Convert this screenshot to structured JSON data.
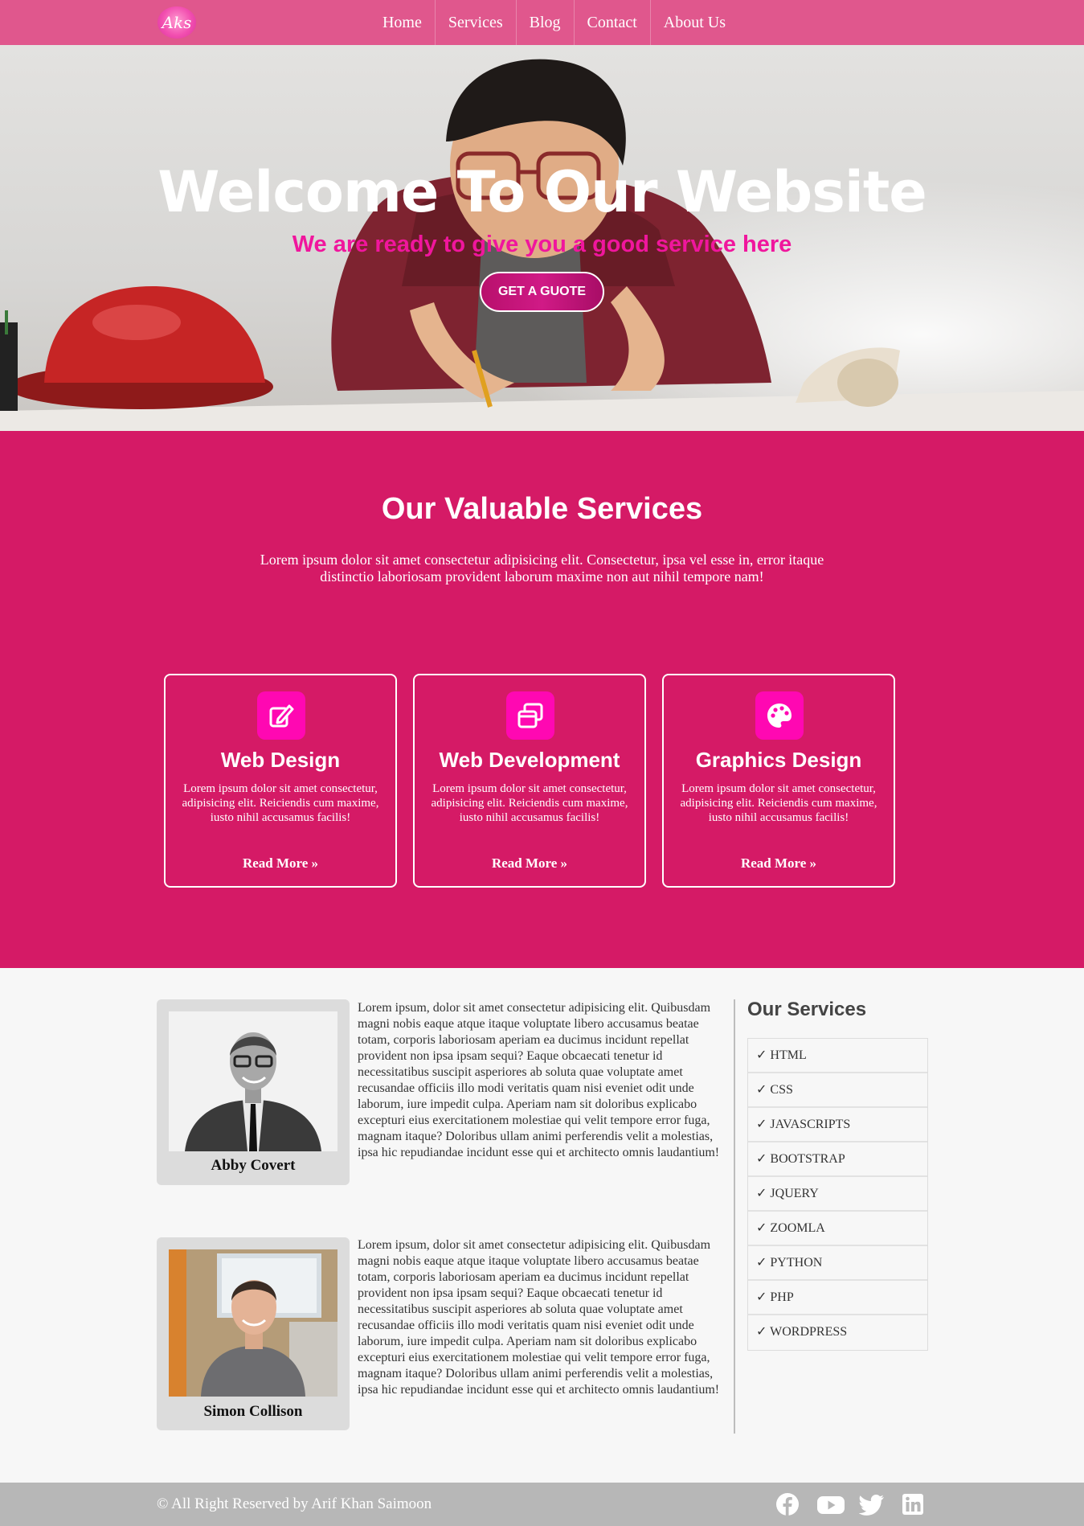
{
  "nav": {
    "logo": "Aks",
    "items": [
      "Home",
      "Services",
      "Blog",
      "Contact",
      "About Us"
    ]
  },
  "hero": {
    "title": "Welcome To Our Website",
    "subtitle": "We are ready to give you a good service here",
    "button": "GET A GUOTE"
  },
  "services_band": {
    "title": "Our Valuable Services",
    "text": "Lorem ipsum dolor sit amet consectetur adipisicing elit. Consectetur, ipsa vel esse in, error itaque distinctio laboriosam provident laborum maxime non aut nihil tempore nam!",
    "cards": [
      {
        "icon": "edit-icon",
        "title": "Web Design",
        "text": "Lorem ipsum dolor sit amet consectetur, adipisicing elit. Reiciendis cum maxime, iusto nihil accusamus facilis!",
        "link": "Read More »"
      },
      {
        "icon": "windows-icon",
        "title": "Web Development",
        "text": "Lorem ipsum dolor sit amet consectetur, adipisicing elit. Reiciendis cum maxime, iusto nihil accusamus facilis!",
        "link": "Read More »"
      },
      {
        "icon": "palette-icon",
        "title": "Graphics Design",
        "text": "Lorem ipsum dolor sit amet consectetur, adipisicing elit. Reiciendis cum maxime, iusto nihil accusamus facilis!",
        "link": "Read More »"
      }
    ]
  },
  "team": [
    {
      "name": "Abby Covert",
      "text": "Lorem ipsum, dolor sit amet consectetur adipisicing elit. Quibusdam magni nobis eaque atque itaque voluptate libero accusamus beatae totam, corporis laboriosam aperiam ea ducimus incidunt repellat provident non ipsa ipsam sequi? Eaque obcaecati tenetur id necessitatibus suscipit asperiores ab soluta quae voluptate amet recusandae officiis illo modi veritatis quam nisi eveniet odit unde laborum, iure impedit culpa. Aperiam nam sit doloribus explicabo excepturi eius exercitationem molestiae qui velit tempore error fuga, magnam itaque? Doloribus ullam animi perferendis velit a molestias, ipsa hic repudiandae incidunt esse qui et architecto omnis laudantium!"
    },
    {
      "name": "Simon Collison",
      "text": "Lorem ipsum, dolor sit amet consectetur adipisicing elit. Quibusdam magni nobis eaque atque itaque voluptate libero accusamus beatae totam, corporis laboriosam aperiam ea ducimus incidunt repellat provident non ipsa ipsam sequi? Eaque obcaecati tenetur id necessitatibus suscipit asperiores ab soluta quae voluptate amet recusandae officiis illo modi veritatis quam nisi eveniet odit unde laborum, iure impedit culpa. Aperiam nam sit doloribus explicabo excepturi eius exercitationem molestiae qui velit tempore error fuga, magnam itaque? Doloribus ullam animi perferendis velit a molestias, ipsa hic repudiandae incidunt esse qui et architecto omnis laudantium!"
    }
  ],
  "sidebar": {
    "title": "Our Services",
    "items": [
      "✓ HTML",
      "✓ CSS",
      "✓ JAVASCRIPTS",
      "✓ BOOTSTRAP",
      "✓ JQUERY",
      "✓ ZOOMLA",
      "✓ PYTHON",
      "✓ PHP",
      "✓ WORDPRESS"
    ]
  },
  "footer": {
    "copyright": "© All Right Reserved by Arif Khan Saimoon",
    "socials": [
      "facebook-icon",
      "youtube-icon",
      "twitter-icon",
      "linkedin-icon"
    ]
  },
  "colors": {
    "nav": "#e0578d",
    "band": "#d51a66",
    "accent": "#f0169d",
    "icon_bg": "#ff08b2",
    "footer": "#b7b7b7"
  }
}
